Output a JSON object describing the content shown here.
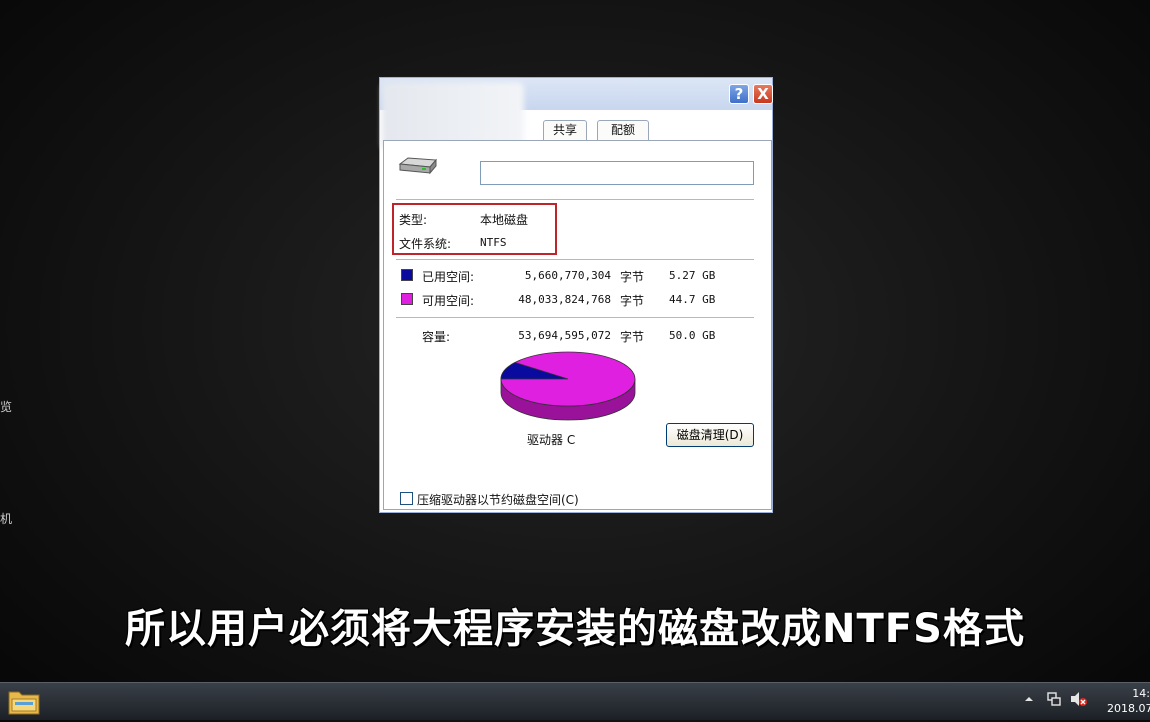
{
  "desktop": {
    "edge_chars": [
      "览",
      "机"
    ]
  },
  "dialog": {
    "tabs": [
      "共享",
      "配额"
    ],
    "help_label": "?",
    "close_label": "X",
    "drive_name_value": "",
    "type_label": "类型:",
    "type_value": "本地磁盘",
    "fs_label": "文件系统:",
    "fs_value": "NTFS",
    "used": {
      "label": "已用空间:",
      "bytes": "5,660,770,304",
      "unit": "字节",
      "size": "5.27 GB",
      "color": "#0a0a9e"
    },
    "free": {
      "label": "可用空间:",
      "bytes": "48,033,824,768",
      "unit": "字节",
      "size": "44.7 GB",
      "color": "#e020e0"
    },
    "capacity": {
      "label": "容量:",
      "bytes": "53,694,595,072",
      "unit": "字节",
      "size": "50.0 GB"
    },
    "used_fraction": 0.105,
    "drive_label": "驱动器 C",
    "cleanup_button": "磁盘清理(D)",
    "compress_label": "压缩驱动器以节约磁盘空间(C)"
  },
  "subtitle": "所以用户必须将大程序安装的磁盘改成NTFS格式",
  "taskbar": {
    "clock_time": "14:",
    "clock_date": "2018.07",
    "tray_icons": [
      "chevron-up-icon",
      "network-icon",
      "volume-muted-icon"
    ]
  }
}
